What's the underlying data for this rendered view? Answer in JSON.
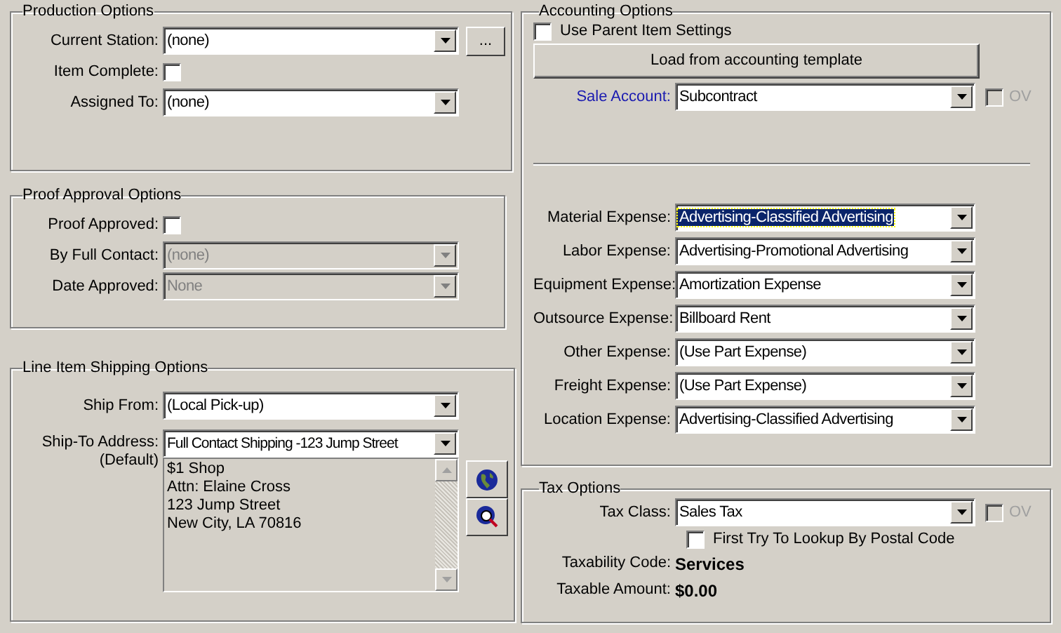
{
  "production_options": {
    "title": "Production Options",
    "fields": [
      {
        "kind": "dropdown",
        "label": "Current Station:",
        "value": "(none)",
        "disabled": false,
        "browse_button": "..."
      },
      {
        "kind": "checkbox",
        "label": "Item Complete:",
        "checked": false
      },
      {
        "kind": "dropdown",
        "label": "Assigned To:",
        "value": "(none)",
        "disabled": false
      }
    ]
  },
  "proof_approval_options": {
    "title": "Proof Approval Options",
    "fields": [
      {
        "kind": "checkbox",
        "label": "Proof Approved:",
        "checked": false
      },
      {
        "kind": "dropdown",
        "label": "By Full Contact:",
        "value": "(none)",
        "disabled": true
      },
      {
        "kind": "dropdown",
        "label": "Date Approved:",
        "value": "None",
        "disabled": true
      }
    ]
  },
  "line_item_shipping_options": {
    "title": "Line Item Shipping Options",
    "ship_from": {
      "label": "Ship From:",
      "value": "(Local Pick-up)"
    },
    "ship_to": {
      "label": "Ship-To Address:",
      "sublabel": "(Default)",
      "value": "Full Contact Shipping -123 Jump Street",
      "address_lines": [
        "$1 Shop",
        "Attn: Elaine Cross",
        "123 Jump Street",
        "New City, LA 70816"
      ]
    }
  },
  "accounting_options": {
    "title": "Accounting Options",
    "use_parent_item_settings": {
      "label": "Use Parent Item Settings",
      "checked": false
    },
    "template_button": "Load from accounting template",
    "sale_account": {
      "label": "Sale Account:",
      "value": "Subcontract",
      "ov_label": "OV",
      "ov_checked": false
    },
    "expenses": [
      {
        "label": "Material Expense:",
        "value": "Advertising-Classified Advertising",
        "selected": true
      },
      {
        "label": "Labor Expense:",
        "value": "Advertising-Promotional Advertising",
        "selected": false
      },
      {
        "label": "Equipment Expense:",
        "value": "Amortization Expense",
        "selected": false
      },
      {
        "label": "Outsource Expense:",
        "value": "Billboard Rent",
        "selected": false
      },
      {
        "label": "Other Expense:",
        "value": "(Use Part Expense)",
        "selected": false
      },
      {
        "label": "Freight Expense:",
        "value": "(Use Part Expense)",
        "selected": false
      },
      {
        "label": "Location Expense:",
        "value": "Advertising-Classified Advertising",
        "selected": false
      }
    ]
  },
  "tax_options": {
    "title": "Tax Options",
    "tax_class": {
      "label": "Tax Class:",
      "value": "Sales Tax",
      "ov_label": "OV",
      "ov_checked": false
    },
    "postal_code_lookup": {
      "label": "First Try To Lookup By Postal Code",
      "checked": false
    },
    "info": [
      {
        "label": "Taxability Code:",
        "value": "Services"
      },
      {
        "label": "Taxable Amount:",
        "value": "$0.00"
      }
    ]
  }
}
